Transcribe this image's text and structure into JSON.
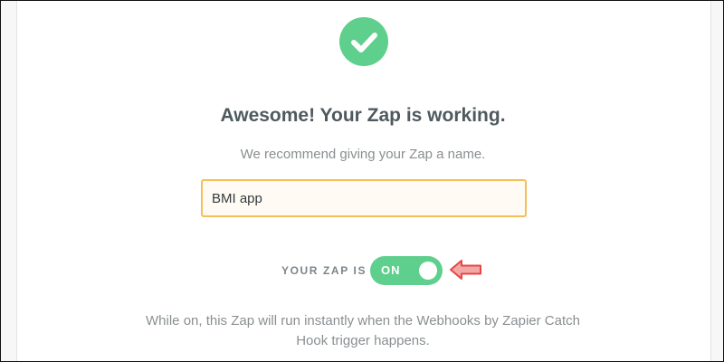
{
  "success": {
    "icon": "checkmark-icon",
    "color": "#5fcf8d"
  },
  "headline": "Awesome! Your Zap is working.",
  "subtext": "We recommend giving your Zap a name.",
  "zap_name": {
    "value": "BMI app"
  },
  "status": {
    "label": "YOUR ZAP IS",
    "toggle_text": "ON",
    "is_on": true,
    "toggle_color": "#5fcf8d"
  },
  "annotation": {
    "icon": "arrow-left-icon",
    "color": "#e84545"
  },
  "info": "While on, this Zap will run instantly when the Webhooks by Zapier Catch Hook trigger happens."
}
